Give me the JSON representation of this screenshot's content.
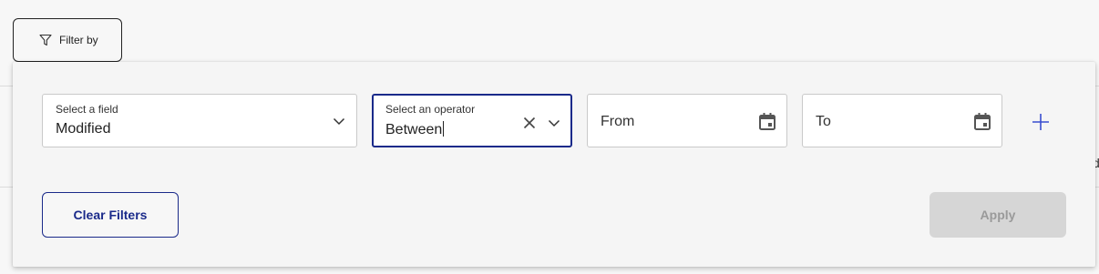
{
  "filter_button": {
    "label": "Filter by",
    "icon": "funnel-icon"
  },
  "background": {
    "edge_glyph": "d"
  },
  "filters": {
    "field_select": {
      "caption": "Select a field",
      "value": "Modified",
      "icon": "chevron-down-icon"
    },
    "operator_select": {
      "caption": "Select an operator",
      "value": "Between",
      "clear_icon": "close-icon",
      "icon": "chevron-down-icon"
    },
    "from_date": {
      "placeholder": "From",
      "icon": "calendar-icon"
    },
    "to_date": {
      "placeholder": "To",
      "icon": "calendar-icon"
    },
    "add_icon": "plus-icon"
  },
  "actions": {
    "clear_label": "Clear Filters",
    "apply_label": "Apply"
  },
  "colors": {
    "accent": "#1a2a8a",
    "add_icon": "#3a4ed0",
    "disabled_bg": "#d6d6d6",
    "disabled_text": "#9a9a9a"
  }
}
